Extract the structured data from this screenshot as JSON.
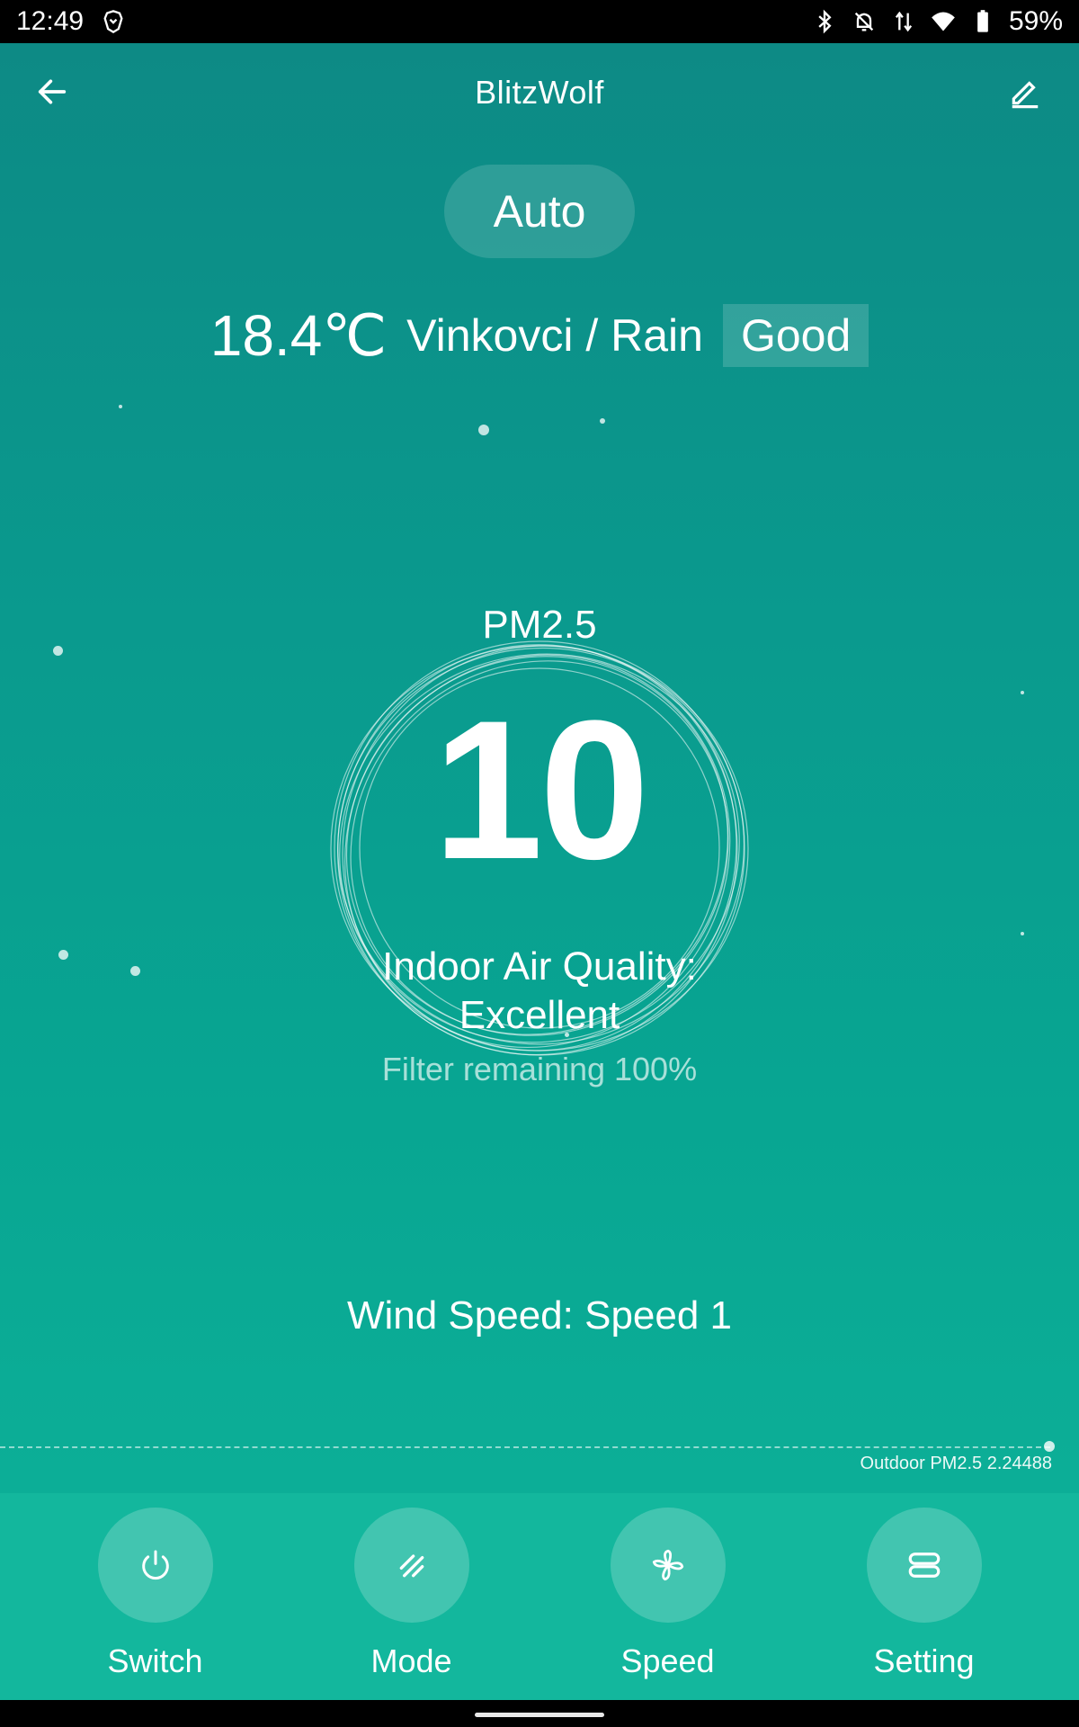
{
  "status_bar": {
    "time": "12:49",
    "battery": "59%",
    "icons": [
      "brave-lion-icon",
      "bluetooth-icon",
      "bell-off-icon",
      "data-arrows-icon",
      "wifi-icon",
      "battery-icon"
    ]
  },
  "header": {
    "title": "BlitzWolf"
  },
  "mode": {
    "label": "Auto"
  },
  "weather": {
    "temperature": "18.4℃",
    "location": "Vinkovci / Rain",
    "outdoor_quality": "Good"
  },
  "indoor": {
    "pm_label": "PM2.5",
    "pm_value": "10",
    "quality_line1": "Indoor Air Quality:",
    "quality_line2": "Excellent",
    "filter": "Filter remaining 100%",
    "wind_speed": "Wind Speed: Speed 1"
  },
  "outdoor": {
    "label": "Outdoor PM2.5 2.24488"
  },
  "nav": {
    "items": [
      {
        "label": "Switch",
        "icon": "power-icon"
      },
      {
        "label": "Mode",
        "icon": "mode-slashes-icon"
      },
      {
        "label": "Speed",
        "icon": "fan-icon"
      },
      {
        "label": "Setting",
        "icon": "settings-stack-icon"
      }
    ]
  },
  "colors": {
    "gradient_top": "#0d8a85",
    "gradient_bottom": "#0fb39a",
    "bottom_bar": "#13b79d"
  }
}
